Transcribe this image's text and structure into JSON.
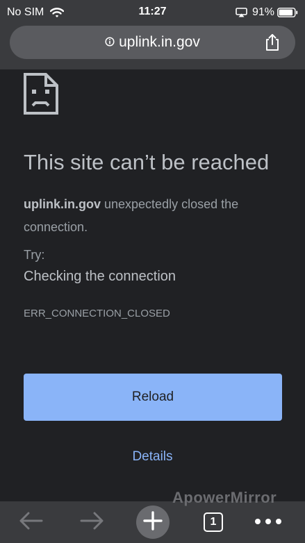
{
  "status_bar": {
    "carrier": "No SIM",
    "time": "11:27",
    "battery_percent": "91%",
    "battery_level": 0.91
  },
  "url_bar": {
    "url": "uplink.in.gov",
    "security_icon": "info-icon",
    "share_icon": "share-icon"
  },
  "error_page": {
    "icon": "sad-page-icon",
    "title": "This site can’t be reached",
    "host": "uplink.in.gov",
    "message": " unexpectedly closed the connection.",
    "try_label": "Try:",
    "suggestion": "Checking the connection",
    "error_code": "ERR_CONNECTION_CLOSED",
    "reload_label": "Reload",
    "details_label": "Details"
  },
  "watermark": "ApowerMirror",
  "toolbar": {
    "back_icon": "arrow-left-icon",
    "forward_icon": "arrow-right-icon",
    "new_tab_icon": "plus-icon",
    "tab_count": "1",
    "menu_icon": "more-dots-icon"
  },
  "colors": {
    "background": "#202124",
    "chrome": "#3a3b3e",
    "accent": "#8ab4f8"
  }
}
